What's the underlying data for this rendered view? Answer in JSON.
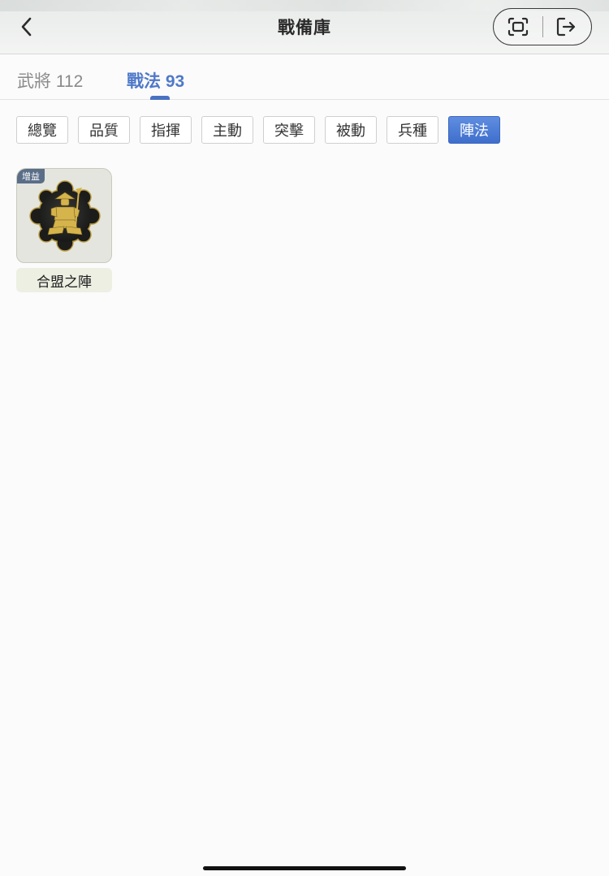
{
  "header": {
    "title": "戰備庫",
    "back_icon": "chevron-left-icon",
    "capsule": {
      "left_icon": "scan-frame-icon",
      "right_icon": "exit-icon"
    }
  },
  "tabs": [
    {
      "label": "武將 112",
      "active": false
    },
    {
      "label": "戰法 93",
      "active": true
    }
  ],
  "filters": [
    {
      "label": "總覽",
      "active": false
    },
    {
      "label": "品質",
      "active": false
    },
    {
      "label": "指揮",
      "active": false
    },
    {
      "label": "主動",
      "active": false
    },
    {
      "label": "突擊",
      "active": false
    },
    {
      "label": "被動",
      "active": false
    },
    {
      "label": "兵種",
      "active": false
    },
    {
      "label": "陣法",
      "active": true
    }
  ],
  "items": [
    {
      "badge": "增益",
      "name": "合盟之陣",
      "icon": "armored-warrior-emblem-icon"
    }
  ],
  "colors": {
    "accent": "#4f79c9",
    "badge": "#5a6e88",
    "emblem_gold": "#d4b24a"
  }
}
